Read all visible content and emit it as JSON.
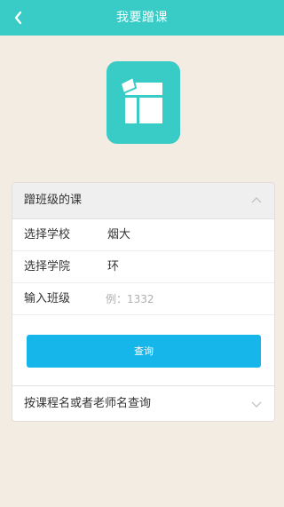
{
  "header": {
    "title": "我要蹭课",
    "back_icon": "chevron-left-icon"
  },
  "logo": {
    "icon": "app-logo-icon",
    "color": "#39cbc6"
  },
  "class_section": {
    "title": "蹭班级的课",
    "expanded": true,
    "rows": [
      {
        "label": "选择学校",
        "value": "烟大"
      },
      {
        "label": "选择学院",
        "value": "环"
      }
    ],
    "class_input": {
      "label": "输入班级",
      "value": "",
      "placeholder": "例：1332"
    },
    "query_button": "查询"
  },
  "name_section": {
    "title": "按课程名或者老师名查询",
    "expanded": false
  },
  "colors": {
    "accent": "#39cbc6",
    "button": "#16b5ea",
    "background": "#f3ece2"
  }
}
